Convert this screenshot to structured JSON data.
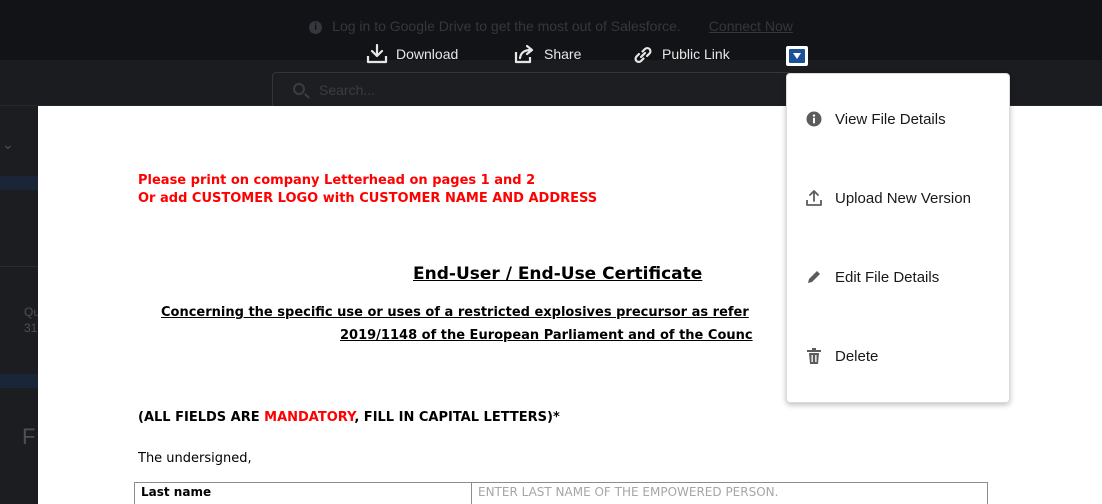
{
  "background": {
    "notice_text": "Log in to Google Drive to get the most out of Salesforce.",
    "notice_link": "Connect Now",
    "search_placeholder": "Search...",
    "side_partial_1": "Qu",
    "side_partial_2": "31",
    "side_partial_3": "F"
  },
  "toolbar": {
    "download_label": "Download",
    "share_label": "Share",
    "public_link_label": "Public Link",
    "more_icon": "caret-down-icon"
  },
  "menu": {
    "items": [
      {
        "label": "View File Details",
        "icon": "info-icon"
      },
      {
        "label": "Upload New Version",
        "icon": "upload-icon"
      },
      {
        "label": "Edit File Details",
        "icon": "pencil-icon"
      },
      {
        "label": "Delete",
        "icon": "trash-icon"
      }
    ]
  },
  "document": {
    "red_note_line1": "Please print on company Letterhead on pages 1 and 2",
    "red_note_line2": "Or add CUSTOMER LOGO with CUSTOMER NAME AND ADDRESS",
    "title": "End-User / End-Use Certificate",
    "subtitle_line1": "Concerning the specific use or uses of a restricted explosives precursor as refer",
    "subtitle_line2": "2019/1148 of the European Parliament and of the Counc",
    "mandatory_prefix": "(ALL FIELDS ARE ",
    "mandatory_word": "MANDATORY",
    "mandatory_suffix": ", FILL IN CAPITAL LETTERS)*",
    "undersigned": "The undersigned,",
    "table": [
      {
        "label": "Last name",
        "value": "ENTER LAST NAME OF THE EMPOWERED PERSON."
      }
    ]
  },
  "colors": {
    "accent_blue": "#1b5297",
    "red_text": "#ff0000",
    "overlay": "#16171a"
  }
}
